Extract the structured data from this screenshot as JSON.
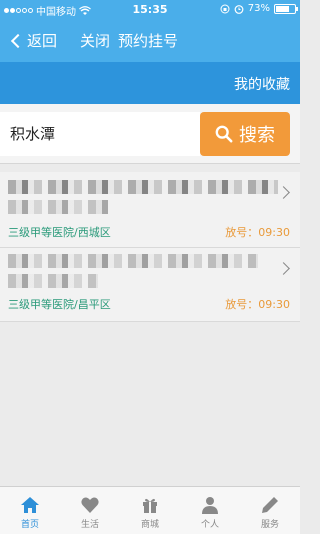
{
  "status_bar": {
    "carrier": "中国移动",
    "time": "15:35",
    "battery": "73%",
    "battery_level": 0.73
  },
  "nav": {
    "back_label": "返回",
    "close_label": "关闭",
    "title": "预约挂号"
  },
  "sub_bar": {
    "favorites_label": "我的收藏"
  },
  "search": {
    "value": "积水潭",
    "button_label": "搜索"
  },
  "results": [
    {
      "meta": "三级甲等医院/西城区",
      "time": "放号：09:30"
    },
    {
      "meta": "三级甲等医院/昌平区",
      "time": "放号：09:30"
    }
  ],
  "tabs": [
    {
      "label": "首页",
      "icon": "home-icon",
      "active": true
    },
    {
      "label": "生活",
      "icon": "heart-icon",
      "active": false
    },
    {
      "label": "商城",
      "icon": "gift-icon",
      "active": false
    },
    {
      "label": "个人",
      "icon": "person-icon",
      "active": false
    },
    {
      "label": "服务",
      "icon": "pencil-icon",
      "active": false
    }
  ],
  "colors": {
    "nav_blue": "#4aaeea",
    "sub_bar_blue": "#2d94dc",
    "search_orange": "#f29a3a",
    "meta_green": "#2a9a7a",
    "time_orange": "#e99a3a",
    "tab_active": "#2d8fd8"
  }
}
